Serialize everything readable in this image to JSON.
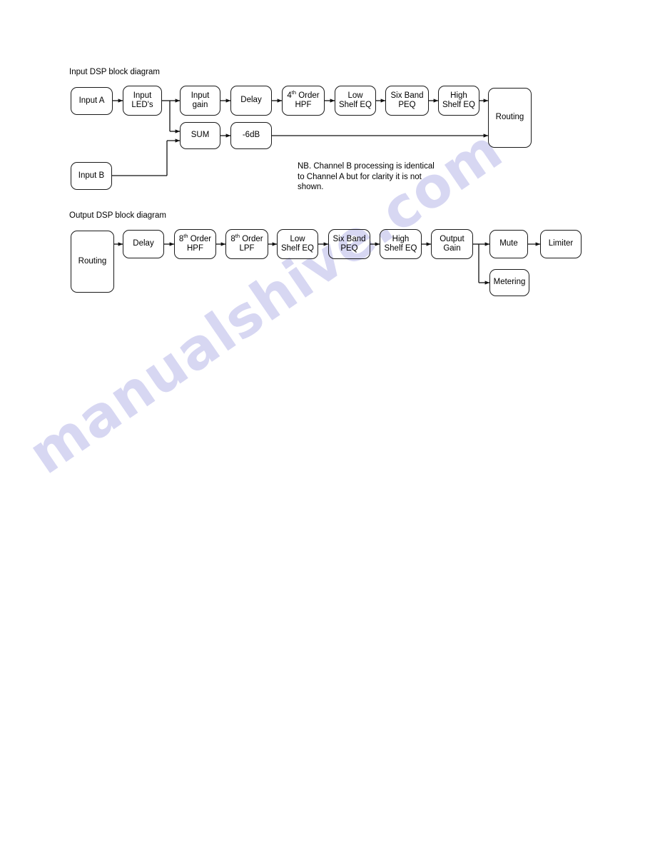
{
  "watermark": {
    "text": "manualshive.com",
    "color": "#d7d7f2"
  },
  "input_diagram": {
    "title": "Input DSP block diagram",
    "note": "NB. Channel B processing is identical to Channel A but for clarity it is not shown.",
    "blocks": {
      "input_a": "Input A",
      "input_leds": "Input\nLED's",
      "input_gain": "Input\ngain",
      "delay": "Delay",
      "hpf_order": "4",
      "hpf_order_suffix": "th",
      "hpf_rest": " Order",
      "hpf_line2": "HPF",
      "low_shelf_eq": "Low\nShelf EQ",
      "six_band_peq": "Six Band\nPEQ",
      "high_shelf_eq": "High\nShelf EQ",
      "routing": "Routing",
      "sum": "SUM",
      "minus6db": "-6dB",
      "input_b": "Input B"
    }
  },
  "output_diagram": {
    "title": "Output DSP block diagram",
    "blocks": {
      "routing": "Routing",
      "delay": "Delay",
      "hpf_order": "8",
      "hpf_order_suffix": "th",
      "hpf_rest": " Order",
      "hpf_line2": "HPF",
      "lpf_order": "8",
      "lpf_order_suffix": "th",
      "lpf_rest": " Order",
      "lpf_line2": "LPF",
      "low_shelf_eq": "Low\nShelf EQ",
      "six_band_peq": "Six Band\nPEQ",
      "high_shelf_eq": "High\nShelf EQ",
      "output_gain": "Output\nGain",
      "mute": "Mute",
      "limiter": "Limiter",
      "metering": "Metering"
    }
  }
}
